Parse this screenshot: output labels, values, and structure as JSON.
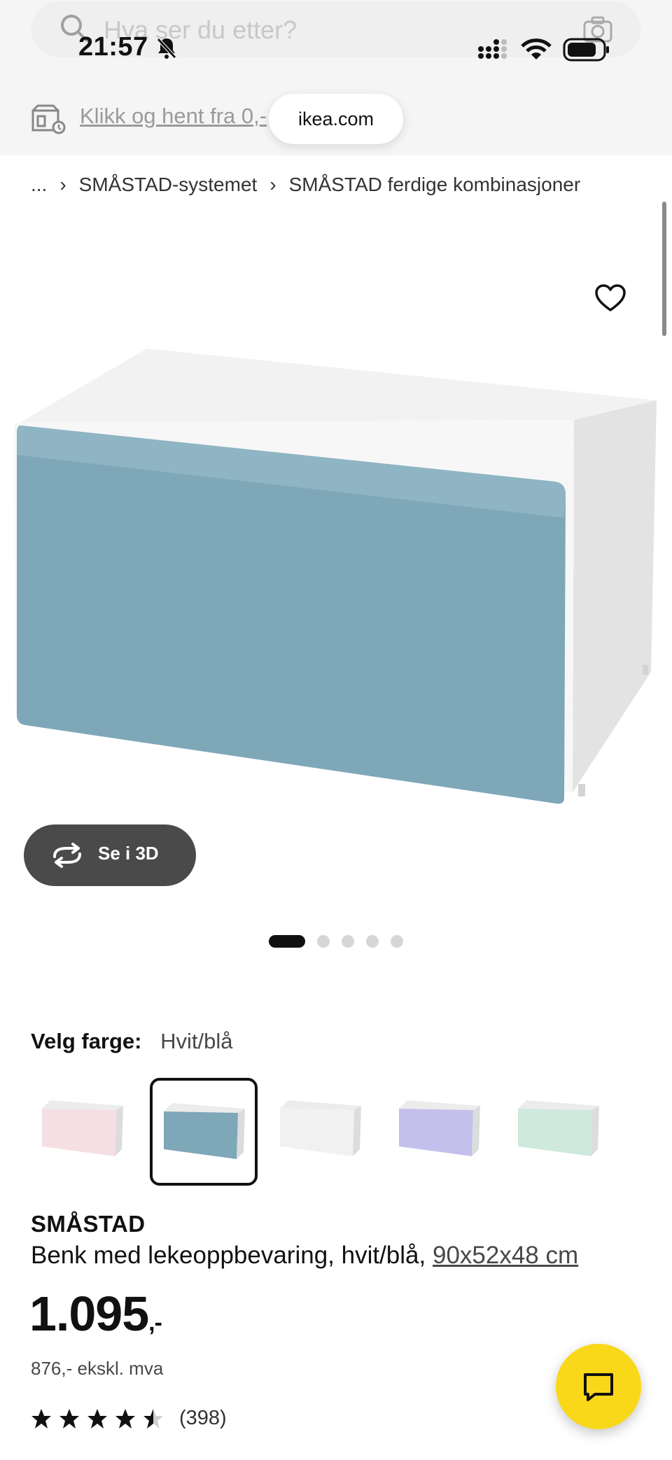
{
  "status_bar": {
    "time": "21:57"
  },
  "search": {
    "placeholder": "Hva ser du etter?"
  },
  "pickup": {
    "text": "Klikk og hent fra 0,-"
  },
  "browser": {
    "url": "ikea.com"
  },
  "breadcrumb": {
    "items": [
      "...",
      "SMÅSTAD-systemet",
      "SMÅSTAD ferdige kombinasjoner"
    ]
  },
  "gallery": {
    "btn_3d_label": "Se i 3D",
    "total_images": 5,
    "active_index": 0
  },
  "color": {
    "label": "Velg farge:",
    "value": "Hvit/blå",
    "swatches": [
      {
        "name": "hvit/rosa",
        "front": "#f6dfe3"
      },
      {
        "name": "hvit/blå",
        "front": "#7ea7b8",
        "selected": true
      },
      {
        "name": "hvit",
        "front": "#f1f1f1"
      },
      {
        "name": "hvit/lilla",
        "front": "#c3c0ec"
      },
      {
        "name": "hvit/grønn",
        "front": "#cfe9dc"
      }
    ]
  },
  "product": {
    "name": "SMÅSTAD",
    "description": "Benk med lekeoppbevaring, hvit/blå,",
    "dimensions": "90x52x48 cm",
    "price": "1.095",
    "price_suffix": ",-",
    "price_ex_vat": "876,- ekskl. mva",
    "rating": 4.5,
    "review_count": "(398)"
  },
  "colors": {
    "accent_yellow": "#f9d819",
    "front_blue": "#7ea7b8"
  }
}
